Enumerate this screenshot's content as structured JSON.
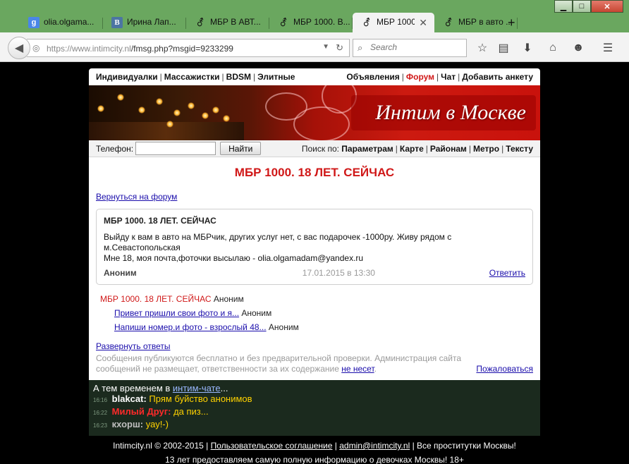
{
  "browser": {
    "tabs": [
      {
        "icon": "google-favicon",
        "glyph": "g",
        "label": "olia.olgama..."
      },
      {
        "icon": "vk-favicon",
        "glyph": "В",
        "label": "Ирина Лап..."
      },
      {
        "icon": "gender-symbol-favicon",
        "glyph": "⚦",
        "label": "МБР В АВТ..."
      },
      {
        "icon": "gender-symbol-favicon",
        "glyph": "⚦",
        "label": "МБР 1000. В..."
      },
      {
        "icon": "gender-symbol-favicon",
        "glyph": "⚦",
        "label": "МБР 1000....",
        "active": true
      },
      {
        "icon": "gender-symbol-favicon",
        "glyph": "⚦",
        "label": "МБР в авто ..."
      }
    ],
    "new_tab": "+",
    "url_host": "https://www.intimcity.nl",
    "url_path": "/fmsg.php?msgid=9233299",
    "search_placeholder": "Search"
  },
  "site": {
    "nav_left": [
      "Индивидуалки",
      "Массажистки",
      "BDSM",
      "Элитные"
    ],
    "nav_right": [
      {
        "label": "Объявления"
      },
      {
        "label": "Форум",
        "highlight": true
      },
      {
        "label": "Чат"
      },
      {
        "label": "Добавить анкету"
      }
    ],
    "banner_caption": "Интим в Москве",
    "phone_label": "Телефон:",
    "find_button": "Найти",
    "search_by_label": "Поиск по:",
    "search_by": [
      "Параметрам",
      "Карте",
      "Районам",
      "Метро",
      "Тексту"
    ]
  },
  "forum": {
    "title": "МБР 1000. 18 ЛЕТ. СЕЙЧАС",
    "back_link": "Вернуться на форум",
    "post": {
      "title": "МБР 1000. 18 ЛЕТ. СЕЙЧАС",
      "body_line1": "Выйду к вам в авто на МБРчик, других услуг нет, с вас подарочек -1000ру. Живу рядом с",
      "body_line2": "м.Севастопольская",
      "body_line3": "Мне 18, моя почта,фоточки высылаю - olia.olgamadam@yandex.ru",
      "author": "Аноним",
      "date": "17.01.2015 в 13:30",
      "reply": "Ответить"
    },
    "thread": {
      "main_title": "МБР 1000. 18 ЛЕТ. СЕЙЧАС",
      "main_author": "Аноним",
      "replies": [
        {
          "title": "Привет пришли свои фото и я...",
          "author": "Аноним"
        },
        {
          "title": "Напиши номер.и фото - взрослый 48...",
          "author": "Аноним"
        }
      ]
    },
    "expand_replies": "Развернуть ответы",
    "disclaimer_text": "Сообщения публикуются бесплатно и без предварительной проверки. Администрация сайта сообщений не размещает, ответственности за их содержание",
    "disclaimer_link": "не несет",
    "disclaimer_end": ".",
    "complain": "Пожаловаться"
  },
  "chat": {
    "head_prefix": "А тем временем в",
    "head_link": "интим-чате",
    "head_suffix": "...",
    "lines": [
      {
        "time": "16:16",
        "nick": "blakcat:",
        "nick_color": "#ffffff",
        "msg": "Прям буйство анонимов"
      },
      {
        "time": "16:22",
        "nick": "Милый Друг:",
        "nick_color": "#ff2a2a",
        "msg": "да пиз..."
      },
      {
        "time": "16:23",
        "nick": "кхорш:",
        "nick_color": "#bfbfbf",
        "msg": "уау!-)"
      }
    ]
  },
  "footer": {
    "line1_pre": "Intimcity.nl © 2002-2015 |",
    "agreement": "Пользовательское соглашение",
    "sep": "|",
    "email": "admin@intimcity.nl",
    "line1_post": "| Все проститутки Москвы!",
    "line2": "13 лет предоставляем самую полную информацию о девочках Москвы! 18+"
  }
}
